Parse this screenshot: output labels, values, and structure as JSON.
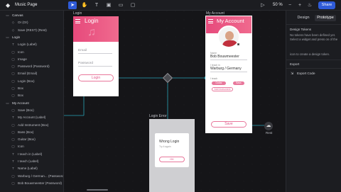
{
  "app": {
    "page_name": "Music Page",
    "zoom": "50 %",
    "share_label": "Share"
  },
  "toolbar": {
    "tools": [
      {
        "name": "select-tool",
        "glyph": "➤"
      },
      {
        "name": "hand-tool",
        "glyph": "✋"
      },
      {
        "name": "text-tool",
        "glyph": "T"
      },
      {
        "name": "frame-tool",
        "glyph": "▣"
      },
      {
        "name": "rectangle-tool",
        "glyph": "▭"
      },
      {
        "name": "comment-tool",
        "glyph": "💬"
      }
    ]
  },
  "layers": [
    {
      "label": "Canvas",
      "icon": "▭",
      "head": true
    },
    {
      "label": "Or (Or)",
      "icon": "◇"
    },
    {
      "label": "Save (REST) (Rest)",
      "icon": "◇"
    },
    {
      "label": "Login",
      "icon": "▭",
      "head": true
    },
    {
      "label": "Login (Label)",
      "icon": "T"
    },
    {
      "label": "Icon",
      "icon": "▢"
    },
    {
      "label": "Image",
      "icon": "▢"
    },
    {
      "label": "Password (Password)",
      "icon": "▢"
    },
    {
      "label": "Email (Email)",
      "icon": "▢"
    },
    {
      "label": "Login (Box)",
      "icon": "▢"
    },
    {
      "label": "Box",
      "icon": "▢"
    },
    {
      "label": "Box",
      "icon": "▢"
    },
    {
      "label": "My Account",
      "icon": "▭",
      "head": true
    },
    {
      "label": "Save (Box)",
      "icon": "▢"
    },
    {
      "label": "My Account (Label)",
      "icon": "T"
    },
    {
      "label": "Add Instrument (Box)",
      "icon": "▢"
    },
    {
      "label": "Bass (Box)",
      "icon": "▢"
    },
    {
      "label": "Guitar (Box)",
      "icon": "▢"
    },
    {
      "label": "Icon",
      "icon": "▢"
    },
    {
      "label": "I teach in (Label)",
      "icon": "T"
    },
    {
      "label": "I teach (Label)",
      "icon": "T"
    },
    {
      "label": "Name (Label)",
      "icon": "T"
    },
    {
      "label": "Warburg / German... (Password)",
      "icon": "▢"
    },
    {
      "label": "Bob Bouwmeester (Password)",
      "icon": "▢"
    }
  ],
  "right_panel": {
    "tabs": [
      "Design",
      "Prototype"
    ],
    "tokens_title": "Design Tokens",
    "tokens_text": "No tokens have been defined yet. Select a widget and press on of the",
    "tokens_text2": "icon to create a design token.",
    "export_title": "Export",
    "export_code": "Export Code"
  },
  "frames": {
    "login": {
      "label": "Login",
      "title": "Login",
      "email_placeholder": "Email",
      "password_placeholder": "Password",
      "button": "Login"
    },
    "account": {
      "label": "My Account",
      "title": "My Account",
      "name_label": "Name",
      "name_value": "Bob Bouwmeester",
      "teach_in_label": "I teach in",
      "teach_in_value": "Warburg / Germany",
      "teach_label": "I teach",
      "tag1": "Guitar",
      "tag2": "Bass",
      "add_instrument": "Add Instrument",
      "save": "Save"
    },
    "error": {
      "label": "Login Error",
      "title": "Wrong Login",
      "subtitle": "Try it again",
      "ok": "OK"
    }
  },
  "nodes": {
    "rest_label": "Rest"
  },
  "colors": {
    "accent": "#2f5bd8",
    "pink": "#e64a7c",
    "link": "#2aa4b7"
  }
}
